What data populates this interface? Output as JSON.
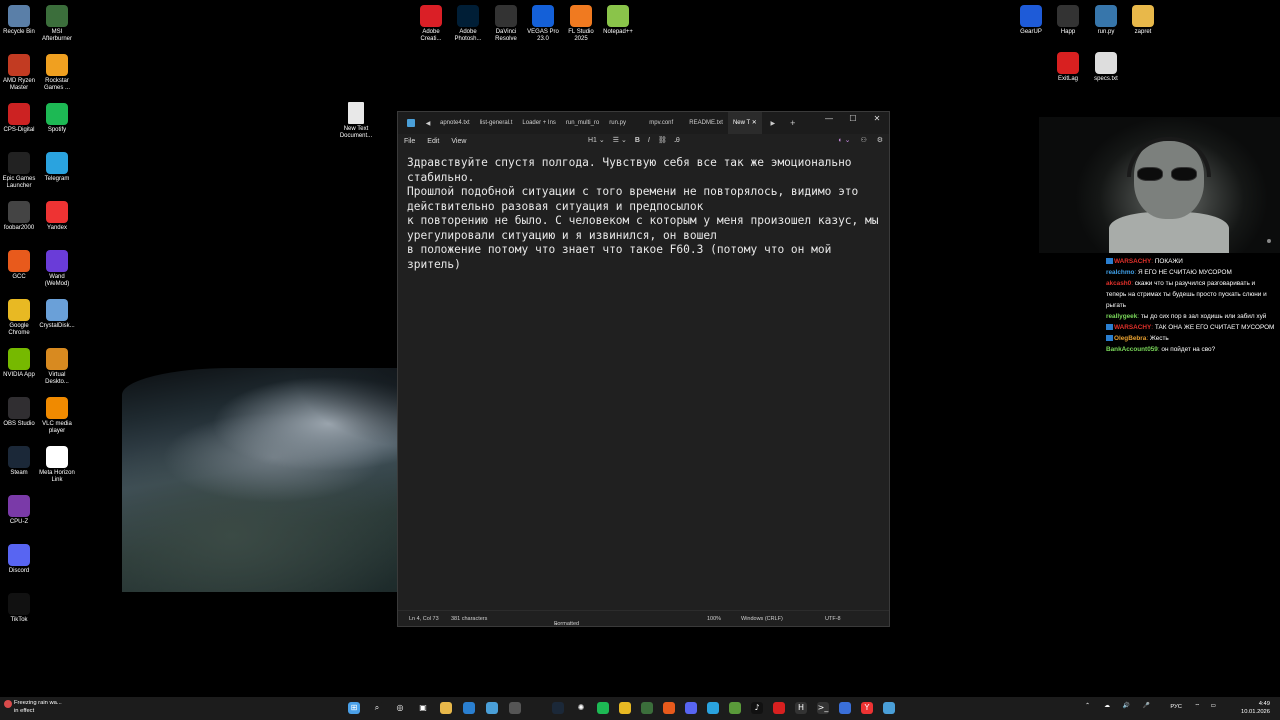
{
  "desktop": {
    "left_icons": [
      {
        "label": "Recycle Bin",
        "icon": "recycle-bin-icon",
        "color": "#5a7fa8"
      },
      {
        "label": "MSI Afterburner",
        "icon": "afterburner-icon",
        "color": "#3b6e3b"
      },
      {
        "label": "AMD Ryzen Master",
        "icon": "ryzen-icon",
        "color": "#c23b22"
      },
      {
        "label": "Rockstar Games ...",
        "icon": "rockstar-icon",
        "color": "#f0a020"
      },
      {
        "label": "CPS-Digital",
        "icon": "cps-icon",
        "color": "#c22"
      },
      {
        "label": "Spotify",
        "icon": "spotify-icon",
        "color": "#1db954"
      },
      {
        "label": "Epic Games Launcher",
        "icon": "epic-icon",
        "color": "#222"
      },
      {
        "label": "Telegram",
        "icon": "telegram-icon",
        "color": "#2aa3df"
      },
      {
        "label": "foobar2000",
        "icon": "foobar-icon",
        "color": "#444"
      },
      {
        "label": "Yandex",
        "icon": "yandex-icon",
        "color": "#e33"
      },
      {
        "label": "GCC",
        "icon": "gcc-icon",
        "color": "#e85a1c"
      },
      {
        "label": "Wand (WeMod)",
        "icon": "wand-icon",
        "color": "#6a3cd8"
      },
      {
        "label": "Google Chrome",
        "icon": "chrome-icon",
        "color": "#e8b923"
      },
      {
        "label": "CrystalDisk...",
        "icon": "crystaldisk-icon",
        "color": "#6aa0d8"
      },
      {
        "label": "NVIDIA App",
        "icon": "nvidia-icon",
        "color": "#76b900"
      },
      {
        "label": "Virtual Deskto...",
        "icon": "virtual-desktop-icon",
        "color": "#d88a20"
      },
      {
        "label": "OBS Studio",
        "icon": "obs-icon",
        "color": "#302e31"
      },
      {
        "label": "VLC media player",
        "icon": "vlc-icon",
        "color": "#f08a00"
      },
      {
        "label": "Steam",
        "icon": "steam-icon",
        "color": "#1b2838"
      },
      {
        "label": "Meta Horizon Link",
        "icon": "meta-icon",
        "color": "#fff"
      },
      {
        "label": "CPU-Z",
        "icon": "cpuz-icon",
        "color": "#7a3aa8"
      },
      {
        "label": "Discord",
        "icon": "discord-icon",
        "color": "#5865f2"
      },
      {
        "label": "TikTok",
        "icon": "tiktok-icon",
        "color": "#111"
      }
    ],
    "top_icons": [
      {
        "label": "Adobe Creati...",
        "icon": "creative-cloud-icon",
        "color": "#da1f26"
      },
      {
        "label": "Adobe Photosh...",
        "icon": "photoshop-icon",
        "color": "#001e36"
      },
      {
        "label": "DaVinci Resolve",
        "icon": "davinci-icon",
        "color": "#333"
      },
      {
        "label": "VEGAS Pro 23.0",
        "icon": "vegas-icon",
        "color": "#1460d8"
      },
      {
        "label": "FL Studio 2025",
        "icon": "flstudio-icon",
        "color": "#f07a20"
      },
      {
        "label": "Notepad++",
        "icon": "notepadpp-icon",
        "color": "#8ac44a"
      }
    ],
    "right_icons": [
      {
        "label": "GearUP",
        "icon": "gearup-icon",
        "color": "#1e5bd8"
      },
      {
        "label": "Happ",
        "icon": "happ-icon",
        "color": "#333"
      },
      {
        "label": "run.py",
        "icon": "python-file-icon",
        "color": "#3776ab"
      },
      {
        "label": "zapret",
        "icon": "folder-icon",
        "color": "#e8b84a"
      },
      {
        "label": "ExitLag",
        "icon": "exitlag-icon",
        "color": "#d82020"
      },
      {
        "label": "specs.txt",
        "icon": "text-file-icon",
        "color": "#ddd"
      }
    ],
    "center_icon": {
      "label": "New Text Document...",
      "icon": "text-file-icon"
    }
  },
  "notepad": {
    "tabs": [
      "apnote4.txt",
      "list-general.t",
      "Loader + Ins",
      "run_multi_ro",
      "run.py",
      "mpv.conf",
      "README.txt",
      "New T"
    ],
    "active_tab": "New T",
    "menu": [
      "File",
      "Edit",
      "View"
    ],
    "heading_select": "H1",
    "content": "Здравствуйте спустя полгода. Чувствую себя все так же эмоционально стабильно.\nПрошлой подобной ситуации с того времени не повторялось, видимо это действительно разовая ситуация и предпосылок\nк повторению не было. С человеком с которым у меня произошел казус, мы урегулировали ситуацию и я извинился, он вошел\nв положение потому что знает что такое F60.3 (потому что он мой зритель)",
    "status": {
      "position": "Ln 4, Col 73",
      "characters": "381 characters",
      "mode": "Formatted",
      "zoom": "100%",
      "line_ending": "Windows (CRLF)",
      "encoding": "UTF-8"
    }
  },
  "chat": [
    {
      "user": "WARSACHY",
      "color": "#e0302a",
      "text": "ПОКАЖИ",
      "badge": true
    },
    {
      "user": "realchmo",
      "color": "#3fa0e8",
      "text": "Я ЕГО НЕ СЧИТАЮ МУСОРОМ",
      "badge": false
    },
    {
      "user": "akcash0",
      "color": "#e0302a",
      "text": "скажи что ты разучился разговаривать и теперь на стримах ты будешь просто пускать слюни и рыгать",
      "badge": false
    },
    {
      "user": "reallygeek",
      "color": "#7ad85a",
      "text": "ты до сих пор в зал ходишь или забил хуй",
      "badge": false
    },
    {
      "user": "WARSACHY",
      "color": "#e0302a",
      "text": "ТАК ОНА ЖЕ ЕГО СЧИТАЕТ МУСОРОМ",
      "badge": true
    },
    {
      "user": "OlegBebra",
      "color": "#e8a030",
      "text": "Жесть",
      "badge": true
    },
    {
      "user": "BankAccount059",
      "color": "#7ad85a",
      "text": "он пойдет на сво?",
      "badge": false
    }
  ],
  "taskbar": {
    "weather_line1": "Freezing rain wa...",
    "weather_line2": "in effect",
    "language": "РУС",
    "time": "4:49",
    "date": "10.01.2026"
  }
}
